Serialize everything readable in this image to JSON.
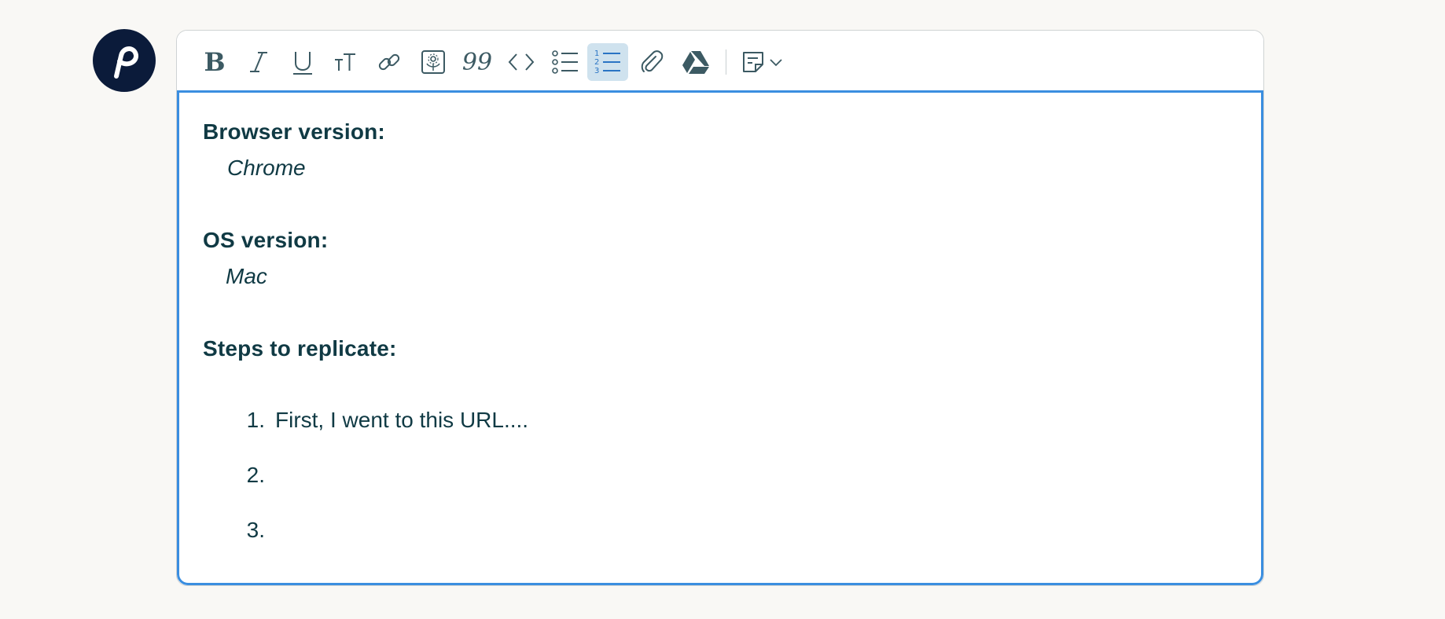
{
  "avatar": {
    "brand_color": "#0b1b3a",
    "icon": "brand-logo-icon"
  },
  "toolbar": {
    "buttons": [
      {
        "name": "bold",
        "icon": "bold-icon",
        "glyph": "B"
      },
      {
        "name": "italic",
        "icon": "italic-icon",
        "glyph": "I"
      },
      {
        "name": "underline",
        "icon": "underline-icon",
        "glyph": "U"
      },
      {
        "name": "text-size",
        "icon": "text-size-icon",
        "glyph": "тТ"
      },
      {
        "name": "link",
        "icon": "link-icon"
      },
      {
        "name": "image",
        "icon": "image-icon"
      },
      {
        "name": "quote",
        "icon": "quote-icon",
        "glyph": "99"
      },
      {
        "name": "code",
        "icon": "code-icon",
        "glyph": "<>"
      },
      {
        "name": "bullet-list",
        "icon": "bullet-list-icon"
      },
      {
        "name": "numbered-list",
        "icon": "numbered-list-icon",
        "active": true
      },
      {
        "name": "attachment",
        "icon": "paperclip-icon"
      },
      {
        "name": "google-drive",
        "icon": "google-drive-icon"
      },
      {
        "name": "template",
        "icon": "template-icon"
      }
    ],
    "active_color": "#2a74c4"
  },
  "editor": {
    "focus_color": "#3a8ee0",
    "fields": [
      {
        "label": "Browser version:",
        "value": "Chrome"
      },
      {
        "label": "OS version:",
        "value": "Mac"
      },
      {
        "label": "Steps to replicate:",
        "value": ""
      }
    ],
    "steps": [
      {
        "num": "1.",
        "text": "First, I went to this URL...."
      },
      {
        "num": "2.",
        "text": ""
      },
      {
        "num": "3.",
        "text": ""
      }
    ]
  }
}
